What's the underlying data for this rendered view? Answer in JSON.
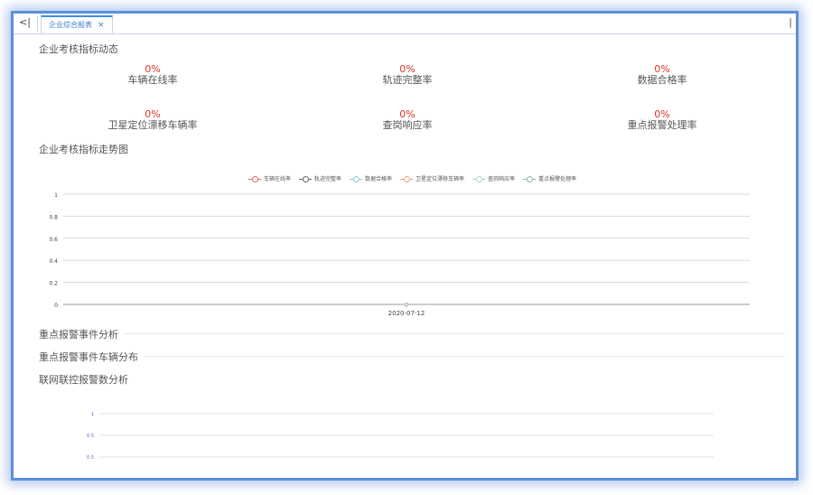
{
  "tabs": {
    "back_label": "<|",
    "active_tab": "企业综合报表",
    "close_label": "×",
    "right_label": "|"
  },
  "sections": {
    "kpi_title": "企业考核指标动态",
    "trend_title": "企业考核指标走势图",
    "alarm_analysis": "重点报警事件分析",
    "alarm_vehicle": "重点报警事件车辆分布",
    "network_alarm": "联网联控报警数分析"
  },
  "kpis": [
    {
      "value": "0%",
      "label": "车辆在线率"
    },
    {
      "value": "0%",
      "label": "轨迹完整率"
    },
    {
      "value": "0%",
      "label": "数据合格率"
    },
    {
      "value": "0%",
      "label": "卫星定位漂移车辆率"
    },
    {
      "value": "0%",
      "label": "查岗响应率"
    },
    {
      "value": "0%",
      "label": "重点报警处理率"
    }
  ],
  "colors": {
    "accent": "#3a8ee6",
    "kpi_value": "#d9342b",
    "frame": "#5b8fdc"
  },
  "chart_data": [
    {
      "type": "line",
      "x": [
        "2020-07-12"
      ],
      "series": [
        {
          "name": "车辆在线率",
          "values": [
            0
          ],
          "color": "#e06666"
        },
        {
          "name": "轨迹完整率",
          "values": [
            0
          ],
          "color": "#666666"
        },
        {
          "name": "数据合格率",
          "values": [
            0
          ],
          "color": "#8ecfcf"
        },
        {
          "name": "卫星定位漂移车辆率",
          "values": [
            0
          ],
          "color": "#f0a080"
        },
        {
          "name": "查岗响应率",
          "values": [
            0
          ],
          "color": "#a8d8b8"
        },
        {
          "name": "重点报警处理率",
          "values": [
            0
          ],
          "color": "#8fb8a8"
        }
      ],
      "y_ticks": [
        "1",
        "0.8",
        "0.6",
        "0.4",
        "0.2",
        "0"
      ],
      "ylim": [
        0,
        1
      ],
      "grid": true,
      "legend": "top"
    },
    {
      "type": "line",
      "y_ticks": [
        "1",
        "0.5",
        "0.5"
      ],
      "grid": true
    }
  ]
}
